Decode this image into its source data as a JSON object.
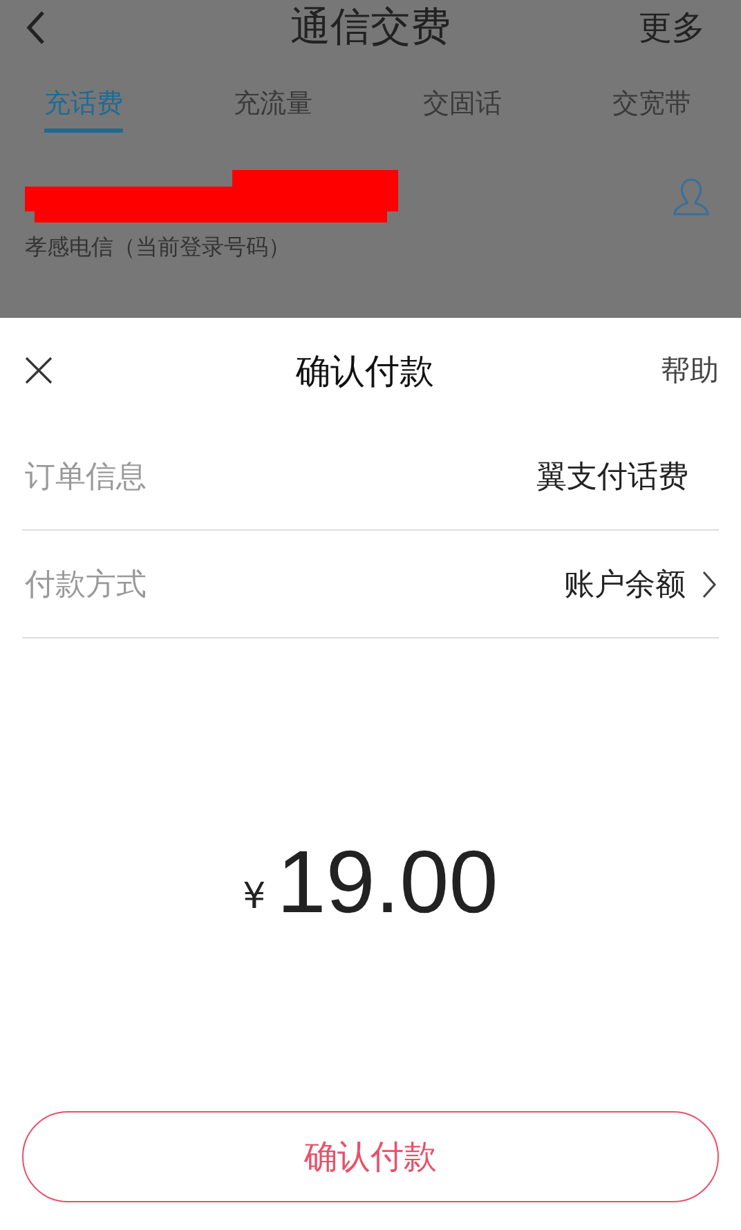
{
  "page": {
    "title": "通信交费",
    "more": "更多",
    "tabs": [
      {
        "label": "充话费",
        "selected": true
      },
      {
        "label": "充流量",
        "selected": false
      },
      {
        "label": "交固话",
        "selected": false
      },
      {
        "label": "交宽带",
        "selected": false
      }
    ],
    "account_note": "孝感电信（当前登录号码）"
  },
  "sheet": {
    "title": "确认付款",
    "help": "帮助",
    "rows": [
      {
        "label": "订单信息",
        "value": "翼支付话费",
        "kind": "plain"
      },
      {
        "label": "付款方式",
        "value": "账户余额",
        "kind": "link"
      }
    ],
    "currency": "¥",
    "amount": "19.00",
    "confirm_button": "确认付款"
  }
}
